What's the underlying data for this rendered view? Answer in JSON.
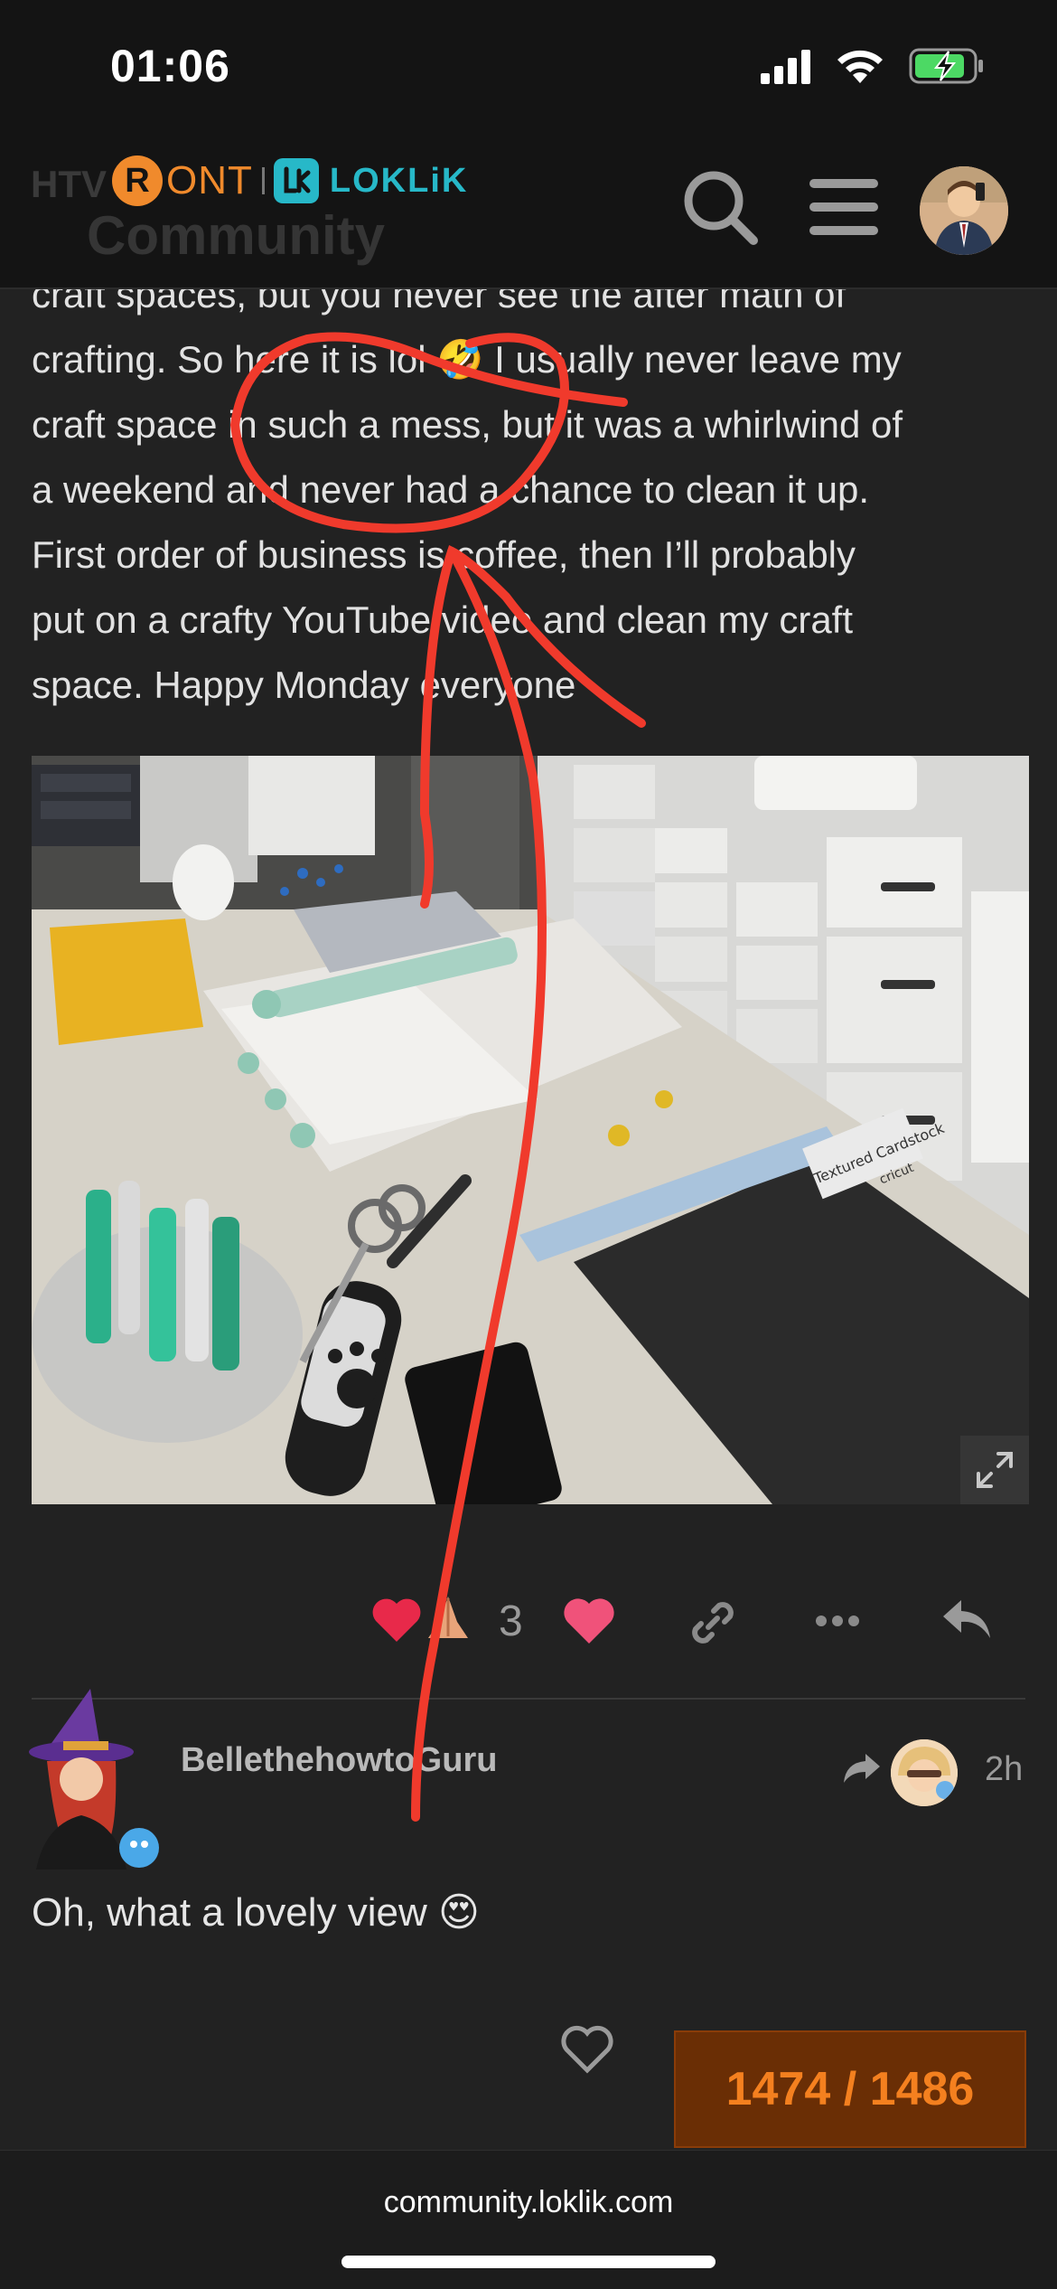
{
  "status_bar": {
    "time": "01:06"
  },
  "header": {
    "ghost_text": "HTV",
    "ghost_community": "Community",
    "logo_r": "R",
    "logo_ont": "ONT",
    "logo_loklik": "LOKLiK"
  },
  "post": {
    "lines": [
      "craft spaces, but you never see the after math of",
      "crafting. So here it is lol 🤣 I usually never leave my",
      "craft space in such a mess, but it was a whirlwind of",
      "a weekend and never had a chance to clean it up.",
      "First order of business is coffee, then I’ll probably",
      "put on a crafty YouTube video and clean my craft",
      "space. Happy Monday everyone"
    ],
    "likes_count": "3",
    "image_labels": {
      "cardstock": "Textured Cardstock",
      "brand": "cricut"
    }
  },
  "reply": {
    "username": "BellethehowtoGuru",
    "time": "2h",
    "text": "Oh, what a lovely view 😍"
  },
  "progress": "1474 / 1486",
  "browser": {
    "url": "community.loklik.com"
  },
  "colors": {
    "accent_orange": "#f08a2c",
    "accent_teal": "#27b8c8",
    "like_red": "#e8294a",
    "annotation_red": "#f03a2c"
  }
}
